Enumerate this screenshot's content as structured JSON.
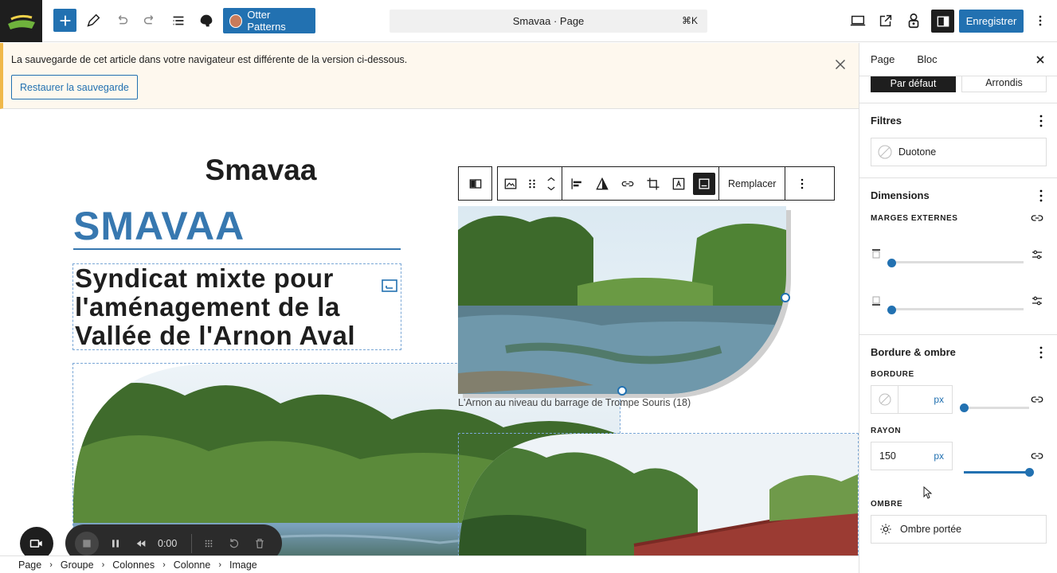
{
  "topbar": {
    "otter_label": "Otter Patterns",
    "command_title": "Smavaa · Page",
    "command_shortcut": "⌘K",
    "save_label": "Enregistrer"
  },
  "notice": {
    "text": "La sauvegarde de cet article dans votre navigateur est différente de la version ci-dessous.",
    "restore_label": "Restaurer la sauvegarde"
  },
  "canvas": {
    "site_title": "Smavaa",
    "brand_heading": "SMAVAA",
    "headline": "Syndicat mixte pour l'aménagement de la Vallée de l'Arnon Aval",
    "caption": "L'Arnon au niveau du barrage de Trompe Souris (18)",
    "toolbar_replace": "Remplacer"
  },
  "recorder": {
    "time": "0:00"
  },
  "breadcrumb": [
    "Page",
    "Groupe",
    "Colonnes",
    "Colonne",
    "Image"
  ],
  "sidebar": {
    "tab_page": "Page",
    "tab_block": "Bloc",
    "style_default": "Par défaut",
    "style_rounded": "Arrondis",
    "filters_title": "Filtres",
    "duotone_label": "Duotone",
    "dimensions_title": "Dimensions",
    "margins_label": "MARGES EXTERNES",
    "border_section_title": "Bordure & ombre",
    "border_label": "BORDURE",
    "border_unit": "px",
    "radius_label": "RAYON",
    "radius_value": "150",
    "radius_unit": "px",
    "shadow_label": "OMBRE",
    "shadow_button": "Ombre portée"
  },
  "colors": {
    "accent": "#2271b1",
    "brand": "#3778b0",
    "notice_border": "#f0b849"
  }
}
